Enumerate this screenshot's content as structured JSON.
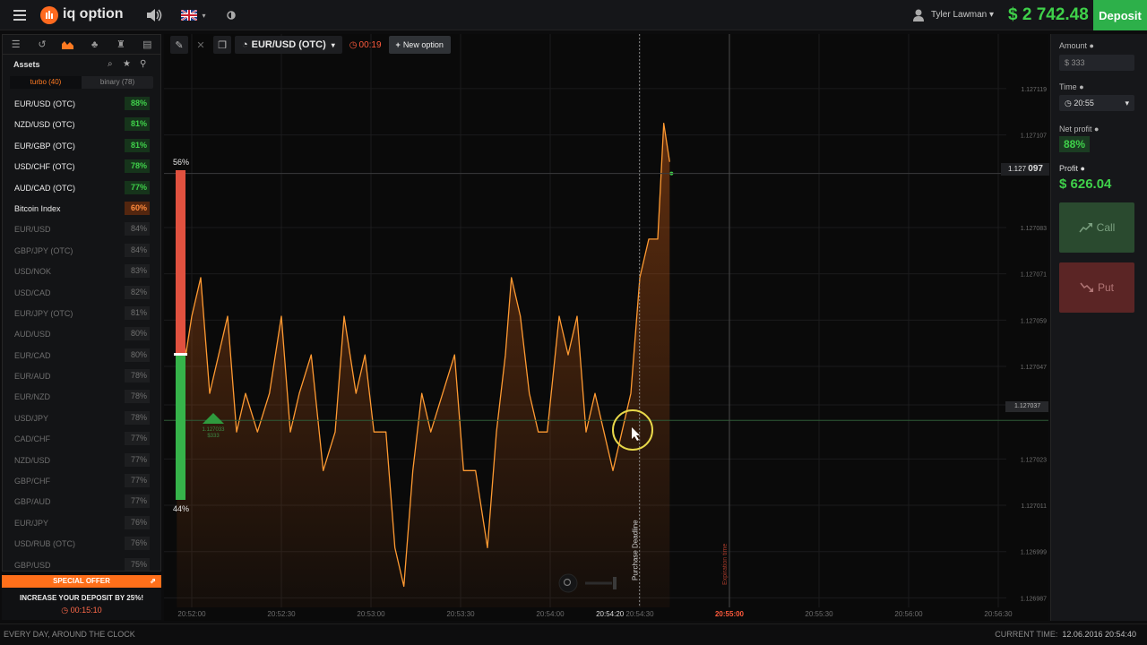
{
  "header": {
    "logo": "iq option",
    "user_name": "Tyler Lawman",
    "balance": "$ 2 742.48",
    "deposit_label": "Deposit"
  },
  "left_panel": {
    "title": "Assets",
    "tab_turbo": "turbo (40)",
    "tab_binary": "binary (78)",
    "assets": [
      {
        "name": "EUR/USD (OTC)",
        "pct": "88%",
        "state": "active"
      },
      {
        "name": "NZD/USD (OTC)",
        "pct": "81%",
        "state": "active"
      },
      {
        "name": "EUR/GBP (OTC)",
        "pct": "81%",
        "state": "active"
      },
      {
        "name": "USD/CHF (OTC)",
        "pct": "78%",
        "state": "active"
      },
      {
        "name": "AUD/CAD (OTC)",
        "pct": "77%",
        "state": "active"
      },
      {
        "name": "Bitcoin Index",
        "pct": "60%",
        "state": "hot"
      },
      {
        "name": "EUR/USD",
        "pct": "84%",
        "state": "dim"
      },
      {
        "name": "GBP/JPY (OTC)",
        "pct": "84%",
        "state": "dim"
      },
      {
        "name": "USD/NOK",
        "pct": "83%",
        "state": "dim"
      },
      {
        "name": "USD/CAD",
        "pct": "82%",
        "state": "dim"
      },
      {
        "name": "EUR/JPY (OTC)",
        "pct": "81%",
        "state": "dim"
      },
      {
        "name": "AUD/USD",
        "pct": "80%",
        "state": "dim"
      },
      {
        "name": "EUR/CAD",
        "pct": "80%",
        "state": "dim"
      },
      {
        "name": "EUR/AUD",
        "pct": "78%",
        "state": "dim"
      },
      {
        "name": "EUR/NZD",
        "pct": "78%",
        "state": "dim"
      },
      {
        "name": "USD/JPY",
        "pct": "78%",
        "state": "dim"
      },
      {
        "name": "CAD/CHF",
        "pct": "77%",
        "state": "dim"
      },
      {
        "name": "NZD/USD",
        "pct": "77%",
        "state": "dim"
      },
      {
        "name": "GBP/CHF",
        "pct": "77%",
        "state": "dim"
      },
      {
        "name": "GBP/AUD",
        "pct": "77%",
        "state": "dim"
      },
      {
        "name": "EUR/JPY",
        "pct": "76%",
        "state": "dim"
      },
      {
        "name": "USD/RUB (OTC)",
        "pct": "76%",
        "state": "dim"
      },
      {
        "name": "GBP/USD",
        "pct": "75%",
        "state": "dim"
      }
    ]
  },
  "offer": {
    "head": "SPECIAL OFFER",
    "text": "INCREASE YOUR DEPOSIT BY 25%!",
    "timer": "00:15:10"
  },
  "footer": {
    "left": "EVERY DAY, AROUND THE CLOCK",
    "current_time_label": "CURRENT TIME:",
    "current_time": "12.06.2016 20:54:40"
  },
  "chart_toolbar": {
    "pair": "EUR/USD (OTC)",
    "timer": "00:19",
    "new_option": "New option"
  },
  "right_panel": {
    "amount_label": "Amount",
    "amount_value": "$ 333",
    "time_label": "Time",
    "time_value": "20:55",
    "net_profit_label": "Net profit",
    "net_profit_value": "88%",
    "profit_label": "Profit",
    "profit_value": "$ 626.04",
    "call_label": "Call",
    "put_label": "Put"
  },
  "chart_data": {
    "type": "line",
    "pair": "EUR/USD (OTC)",
    "current_price": "1.127097",
    "current_price_main": "1.127",
    "current_price_tail": "097",
    "strike_price": "1.127037",
    "put_percent": "56%",
    "call_percent": "44%",
    "bet_price": "1.127033",
    "bet_amount": "$333",
    "purchase_deadline_label": "Purchase Deadline",
    "expiration_label": "Expiration time",
    "y_ticks": [
      "1.127119",
      "1.127107",
      "1.127083",
      "1.127071",
      "1.127059",
      "1.127047",
      "1.127037",
      "1.127023",
      "1.127011",
      "1.126999",
      "1.126987"
    ],
    "x_ticks": [
      "20:52:00",
      "20:52:30",
      "20:53:00",
      "20:53:30",
      "20:54:00",
      "20:54:20",
      "20:54:30",
      "20:55:00",
      "20:55:30",
      "20:56:00",
      "20:56:30"
    ],
    "highlight_x": [
      "20:54:20",
      "20:55:00"
    ],
    "price_series": [
      [
        "20:51:55",
        1.12707
      ],
      [
        "20:51:58",
        1.12705
      ],
      [
        "20:52:00",
        1.12706
      ],
      [
        "20:52:03",
        1.12707
      ],
      [
        "20:52:06",
        1.12704
      ],
      [
        "20:52:09",
        1.12705
      ],
      [
        "20:52:12",
        1.12706
      ],
      [
        "20:52:15",
        1.12703
      ],
      [
        "20:52:18",
        1.12704
      ],
      [
        "20:52:22",
        1.12703
      ],
      [
        "20:52:26",
        1.12704
      ],
      [
        "20:52:30",
        1.12706
      ],
      [
        "20:52:33",
        1.12703
      ],
      [
        "20:52:36",
        1.12704
      ],
      [
        "20:52:40",
        1.12705
      ],
      [
        "20:52:44",
        1.12702
      ],
      [
        "20:52:48",
        1.12703
      ],
      [
        "20:52:51",
        1.12706
      ],
      [
        "20:52:55",
        1.12704
      ],
      [
        "20:52:58",
        1.12705
      ],
      [
        "20:53:01",
        1.12703
      ],
      [
        "20:53:05",
        1.12703
      ],
      [
        "20:53:08",
        1.127
      ],
      [
        "20:53:11",
        1.12699
      ],
      [
        "20:53:14",
        1.12702
      ],
      [
        "20:53:17",
        1.12704
      ],
      [
        "20:53:20",
        1.12703
      ],
      [
        "20:53:24",
        1.12704
      ],
      [
        "20:53:28",
        1.12705
      ],
      [
        "20:53:31",
        1.12702
      ],
      [
        "20:53:35",
        1.12702
      ],
      [
        "20:53:39",
        1.127
      ],
      [
        "20:53:42",
        1.12703
      ],
      [
        "20:53:45",
        1.12705
      ],
      [
        "20:53:47",
        1.12707
      ],
      [
        "20:53:50",
        1.12706
      ],
      [
        "20:53:53",
        1.12704
      ],
      [
        "20:53:56",
        1.12703
      ],
      [
        "20:53:59",
        1.12703
      ],
      [
        "20:54:03",
        1.12706
      ],
      [
        "20:54:06",
        1.12705
      ],
      [
        "20:54:09",
        1.12706
      ],
      [
        "20:54:12",
        1.12703
      ],
      [
        "20:54:15",
        1.12704
      ],
      [
        "20:54:18",
        1.12703
      ],
      [
        "20:54:21",
        1.12702
      ],
      [
        "20:54:24",
        1.12703
      ],
      [
        "20:54:27",
        1.12704
      ],
      [
        "20:54:30",
        1.12707
      ],
      [
        "20:54:33",
        1.12708
      ],
      [
        "20:54:36",
        1.12708
      ],
      [
        "20:54:38",
        1.12711
      ],
      [
        "20:54:40",
        1.1271
      ]
    ]
  }
}
